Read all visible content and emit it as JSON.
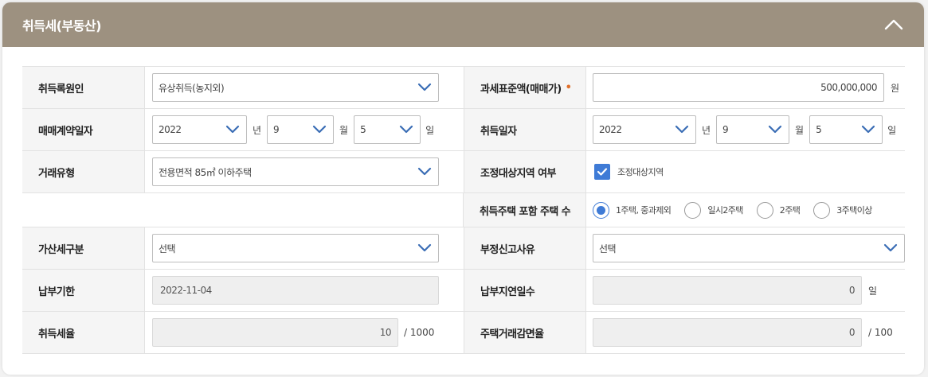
{
  "header": {
    "title": "취득세(부동산)"
  },
  "colors": {
    "header_bg": "#9d9180",
    "accent": "#3f7bd6",
    "required": "#e0702b"
  },
  "rows": {
    "cause": {
      "label": "취득록원인",
      "value": "유상취득(농지외)"
    },
    "tax_base": {
      "label": "과세표준액(매매가)",
      "required_mark": "•",
      "value": "500,000,000",
      "unit": "원"
    },
    "contract_date": {
      "label": "매매계약일자",
      "year": "2022",
      "year_unit": "년",
      "month": "9",
      "month_unit": "월",
      "day": "5",
      "day_unit": "일"
    },
    "acq_date": {
      "label": "취득일자",
      "year": "2022",
      "year_unit": "년",
      "month": "9",
      "month_unit": "월",
      "day": "5",
      "day_unit": "일"
    },
    "trade_type": {
      "label": "거래유형",
      "value": "전용면적 85㎡ 이하주택"
    },
    "adjusted_area": {
      "label": "조정대상지역 여부",
      "checkbox_label": "조정대상지역",
      "checked": true
    },
    "house_count": {
      "label": "취득주택 포함 주택 수",
      "options": [
        "1주택, 중과제외",
        "일시2주택",
        "2주택",
        "3주택이상"
      ],
      "selected": "1주택, 중과제외"
    },
    "surcharge": {
      "label": "가산세구분",
      "value": "선택"
    },
    "unfair_reason": {
      "label": "부정신고사유",
      "value": "선택"
    },
    "due_date": {
      "label": "납부기한",
      "value": "2022-11-04"
    },
    "delay_days": {
      "label": "납부지연일수",
      "value": "0",
      "unit": "일"
    },
    "tax_rate": {
      "label": "취득세율",
      "value": "10",
      "unit": "/ 1000"
    },
    "reduction_rate": {
      "label": "주택거래감면율",
      "value": "0",
      "unit": "/ 100"
    }
  }
}
